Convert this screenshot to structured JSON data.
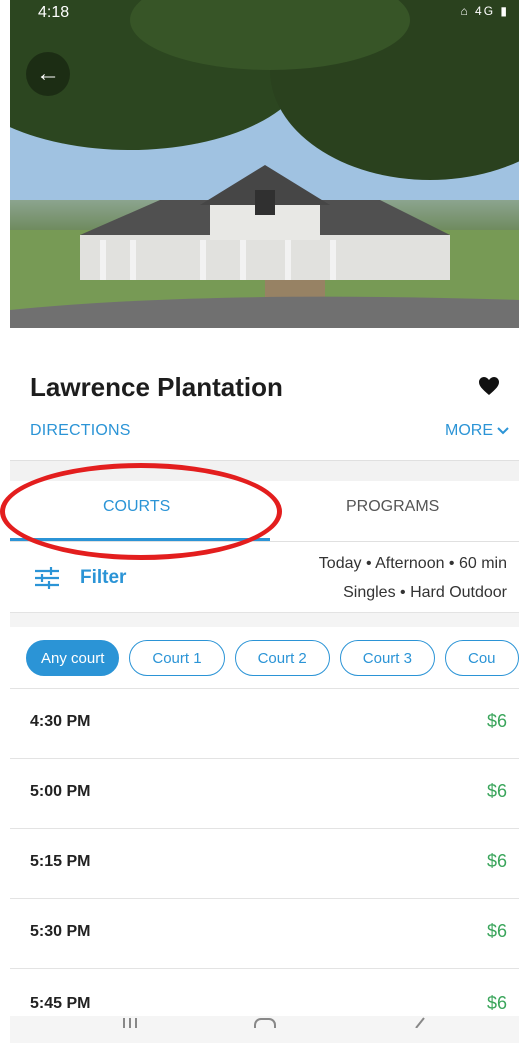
{
  "status": {
    "time": "4:18",
    "icons": "⌂ 4G ▮"
  },
  "venue": {
    "name": "Lawrence Plantation"
  },
  "links": {
    "directions": "DIRECTIONS",
    "more": "MORE"
  },
  "tabs": [
    {
      "label": "COURTS",
      "active": true
    },
    {
      "label": "PROGRAMS",
      "active": false
    }
  ],
  "filter": {
    "label": "Filter",
    "summary_line1": "Today • Afternoon • 60 min",
    "summary_line2": "Singles • Hard Outdoor"
  },
  "chips": [
    "Any court",
    "Court 1",
    "Court 2",
    "Court 3",
    "Cou"
  ],
  "slots": [
    {
      "time": "4:30 PM",
      "price": "$6"
    },
    {
      "time": "5:00 PM",
      "price": "$6"
    },
    {
      "time": "5:15 PM",
      "price": "$6"
    },
    {
      "time": "5:30 PM",
      "price": "$6"
    },
    {
      "time": "5:45 PM",
      "price": "$6"
    }
  ],
  "colors": {
    "accent": "#2b94d6",
    "price": "#3aa55b",
    "annotation": "#e31e1e"
  }
}
